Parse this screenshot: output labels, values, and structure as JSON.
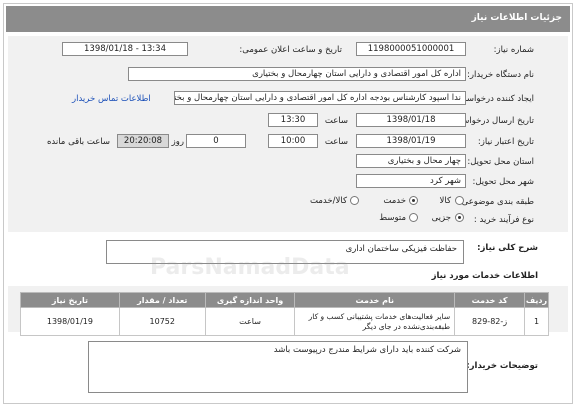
{
  "header": {
    "title": "جزئیات اطلاعات نیاز"
  },
  "fields": {
    "need_number_label": "شماره نیاز:",
    "need_number": "1198000051000001",
    "announce_label": "تاریخ و ساعت اعلان عمومی:",
    "announce_value": "1398/01/18 - 13:34",
    "buyer_org_label": "نام دستگاه خریدار:",
    "buyer_org": "اداره کل امور اقتصادی و دارایی استان چهارمحال و بختیاری",
    "creator_label": "ایجاد کننده درخواست:",
    "creator": "ندا اسپود کارشناس بودجه اداره کل امور اقتصادی و دارایی استان چهارمحال و بختیاری",
    "buyer_contact_link": "اطلاعات تماس خریدار",
    "send_date_label": "تاریخ ارسال درخواست:",
    "send_date": "1398/01/18",
    "time_label": "ساعت",
    "send_time": "13:30",
    "validity_label": "تاریخ اعتبار نیاز:",
    "validity_date": "1398/01/19",
    "validity_time": "10:00",
    "days_value": "0",
    "day_and_label": "روز و",
    "remaining_time": "20:20:08",
    "remaining_label": "ساعت باقی مانده",
    "province_label": "استان محل تحویل:",
    "province": "چهار محال و بختیاری",
    "city_label": "شهر محل تحویل:",
    "city": "شهر کرد",
    "category_label": "طبقه بندی موضوعی:",
    "category_options": [
      "کالا",
      "خدمت",
      "کالا/خدمت"
    ],
    "category_selected": "خدمت",
    "process_label": "نوع فرآیند خرید :",
    "process_options": [
      "جزیی",
      "متوسط"
    ],
    "process_selected": "جزیی"
  },
  "summary": {
    "label": "شرح کلی نیاز:",
    "value": "حفاظت فیزیکی ساختمان اداری"
  },
  "services_section": {
    "title": "اطلاعات خدمات مورد نیاز",
    "columns": [
      "ردیف",
      "کد خدمت",
      "نام خدمت",
      "واحد اندازه گیری",
      "تعداد / مقدار",
      "تاریخ نیاز"
    ],
    "rows": [
      {
        "row": "1",
        "code": "ز-82-829",
        "name": "سایر فعالیت‌های خدمات پشتیبانی کسب و کار طبقه‌بندی‌نشده در جای دیگر",
        "unit": "ساعت",
        "qty": "10752",
        "date": "1398/01/19"
      }
    ]
  },
  "buyer_notes": {
    "label": "توضیحات خریدار:",
    "value": "شرکت کننده باید دارای شرایط مندرج درپیوست باشد"
  },
  "watermark_text": "ParsNamadData"
}
